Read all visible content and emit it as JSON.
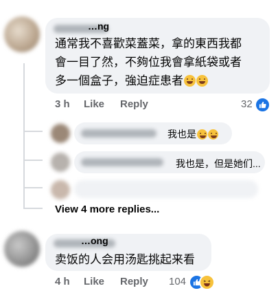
{
  "comments": [
    {
      "author": "…ng",
      "text_line1": "通常我不喜歡菜蓋菜，拿的東西我都",
      "text_line2": "會一目了然，不夠位我會拿紙袋或者",
      "text_line3": "多一個盒子，強迫症患者",
      "time": "3 h",
      "like_label": "Like",
      "reply_label": "Reply",
      "reaction_count": "32"
    },
    {
      "author": "…ong",
      "text": "卖饭的人会用汤匙挑起来看",
      "time": "4 h",
      "like_label": "Like",
      "reply_label": "Reply",
      "reaction_count": "104"
    }
  ],
  "replies": [
    {
      "text": "我也是"
    },
    {
      "text": "我也是，但是她们..."
    }
  ],
  "view_more_label": "View 4 more replies...",
  "colors": {
    "bubble": "#f0f2f5",
    "meta_text": "#65676b",
    "like_blue": "#1b74e4",
    "haha_yellow": "#f7c23c"
  },
  "icons": [
    "like-reaction-icon",
    "haha-reaction-icon",
    "grin-emoji-icon",
    "laugh-cry-emoji-icon"
  ]
}
